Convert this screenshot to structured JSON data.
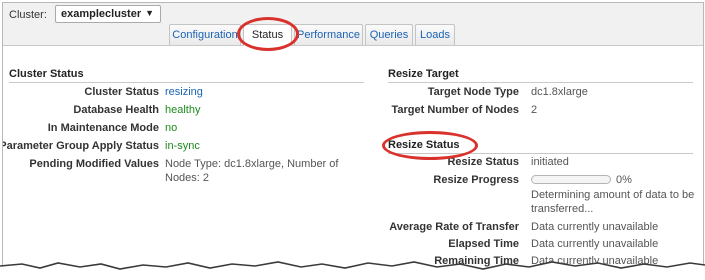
{
  "header": {
    "cluster_label": "Cluster:",
    "cluster_value": "examplecluster",
    "tabs": [
      {
        "label": "Configuration",
        "active": false
      },
      {
        "label": "Status",
        "active": true
      },
      {
        "label": "Performance",
        "active": false
      },
      {
        "label": "Queries",
        "active": false
      },
      {
        "label": "Loads",
        "active": false
      }
    ]
  },
  "cluster_status": {
    "title": "Cluster Status",
    "rows": [
      {
        "label": "Cluster Status",
        "value": "resizing"
      },
      {
        "label": "Database Health",
        "value": "healthy"
      },
      {
        "label": "In Maintenance Mode",
        "value": "no"
      },
      {
        "label": "Parameter Group Apply Status",
        "value": "in-sync"
      },
      {
        "label": "Pending Modified Values",
        "value": "Node Type: dc1.8xlarge, Number of",
        "value_2": "Nodes: 2"
      }
    ]
  },
  "resize_target": {
    "title": "Resize Target",
    "rows": [
      {
        "label": "Target Node Type",
        "value": "dc1.8xlarge"
      },
      {
        "label": "Target Number of Nodes",
        "value": "2"
      }
    ]
  },
  "resize_status": {
    "title": "Resize Status",
    "status_label": "Resize Status",
    "status_value": "initiated",
    "progress_label": "Resize Progress",
    "progress_fraction": 0,
    "progress_text": "0%",
    "progress_note_1": "Determining amount of data to be",
    "progress_note_2": "transferred...",
    "rows": [
      {
        "label": "Average Rate of Transfer",
        "value": "Data currently unavailable"
      },
      {
        "label": "Elapsed Time",
        "value": "Data currently unavailable"
      },
      {
        "label": "Remaining Time",
        "value": "Data currently unavailable"
      }
    ]
  },
  "colors": {
    "highlight": "#d9312b",
    "link": "#1a63b4",
    "healthy": "#1e8c1e"
  }
}
